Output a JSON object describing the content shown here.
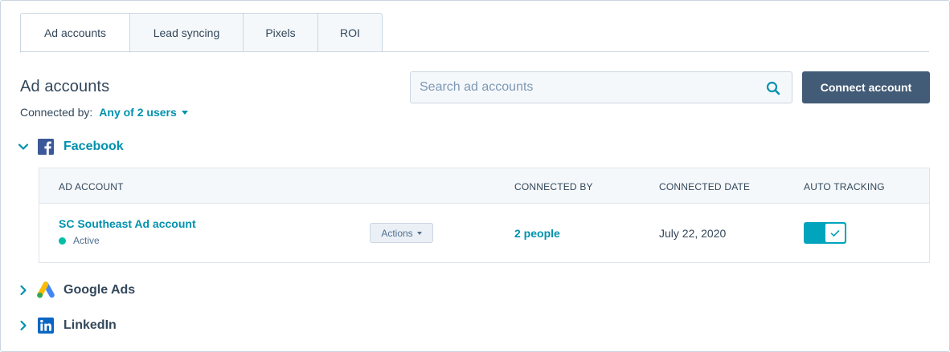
{
  "tabs": [
    {
      "label": "Ad accounts",
      "active": true
    },
    {
      "label": "Lead syncing",
      "active": false
    },
    {
      "label": "Pixels",
      "active": false
    },
    {
      "label": "ROI",
      "active": false
    }
  ],
  "header": {
    "title": "Ad accounts",
    "connected_by_label": "Connected by:",
    "connected_by_value": "Any of 2 users"
  },
  "search": {
    "placeholder": "Search ad accounts",
    "value": ""
  },
  "connect_button_label": "Connect account",
  "sections": {
    "facebook": {
      "name": "Facebook",
      "expanded": true,
      "columns": [
        "AD ACCOUNT",
        "CONNECTED BY",
        "CONNECTED DATE",
        "AUTO TRACKING"
      ],
      "rows": [
        {
          "account_name": "SC Southeast Ad account",
          "status": "Active",
          "actions_label": "Actions",
          "connected_by": "2 people",
          "connected_date": "July 22, 2020",
          "auto_tracking": true
        }
      ]
    },
    "google": {
      "name": "Google Ads",
      "expanded": false
    },
    "linkedin": {
      "name": "LinkedIn",
      "expanded": false
    }
  },
  "colors": {
    "accent": "#0091ae",
    "primary_button": "#425b76",
    "toggle_on": "#00a4bd",
    "status_active": "#00bda5",
    "facebook_blue": "#3b5998",
    "linkedin_blue": "#0a66c2"
  },
  "icons": {
    "search": "search-icon",
    "expand": "chevron-down-icon",
    "collapse": "chevron-right-icon",
    "check": "check-icon",
    "facebook": "facebook-logo-icon",
    "google_ads": "google-ads-logo-icon",
    "linkedin": "linkedin-logo-icon"
  }
}
